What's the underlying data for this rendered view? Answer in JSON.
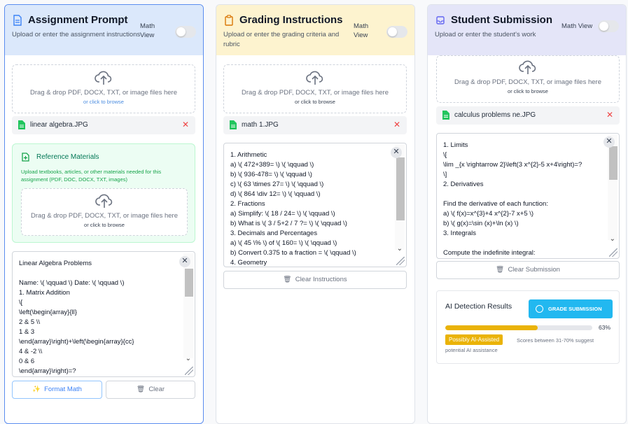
{
  "assignment": {
    "title": "Assignment Prompt",
    "subtitle": "Upload or enter the assignment instructions",
    "math_view": "Math\nView",
    "drop_text": "Drag & drop PDF, DOCX, TXT, or image files here",
    "drop_sub": "or click to browse",
    "file_name": "linear algebra.JPG",
    "reference": {
      "title": "Reference Materials",
      "subtitle": "Upload textbooks, articles, or other materials needed for this assignment (PDF, DOC, DOCX, TXT, images)",
      "drop_text": "Drag & drop PDF, DOCX, TXT, or image files here",
      "drop_sub": "or click to browse"
    },
    "text": "Linear Algebra Problems\n\nName: \\( \\qquad \\) Date: \\( \\qquad \\)\n1. Matrix Addition\n\\[\n\\left(\\begin{array}{ll}\n2 & 5 \\\\\n1 & 3\n\\end{array}\\right)+\\left(\\begin{array}{cc}\n4 & -2 \\\\\n0 & 6\n\\end{array}\\right)=?",
    "format_label": "Format Math",
    "clear_label": "Clear"
  },
  "grading": {
    "title": "Grading Instructions",
    "subtitle": "Upload or enter the grading criteria and rubric",
    "math_view": "Math\nView",
    "drop_text": "Drag & drop PDF, DOCX, TXT, or image files here",
    "drop_sub": "or click to browse",
    "file_name": "math 1.JPG",
    "text": "1. Arithmetic\na) \\( 472+389= \\) \\( \\qquad \\)\nb) \\( 936-478= \\) \\( \\qquad \\)\nc) \\( 63 \\times 27= \\) \\( \\qquad \\)\nd) \\( 864 \\div 12= \\) \\( \\qquad \\)\n2. Fractions\na) Simplify: \\( 18 / 24= \\) \\( \\qquad \\)\nb) What is \\( 3 / 5+2 / 7 ?= \\) \\( \\qquad \\)\n3. Decimals and Percentages\na) \\( 45 \\% \\) of \\( 160= \\) \\( \\qquad \\)\nb) Convert 0.375 to a fraction = \\( \\qquad \\)\n4. Geometry",
    "clear_label": "Clear Instructions"
  },
  "submission": {
    "title": "Student Submission",
    "subtitle": "Upload or enter the student's work",
    "math_view": "Math View",
    "drop_text": "Drag & drop PDF, DOCX, TXT, or image files here",
    "drop_sub": "or click to browse",
    "file_name": "calculus problems ne.JPG",
    "text": "1. Limits\n\\[\n\\lim _{x \\rightarrow 2}\\left(3 x^{2}-5 x+4\\right)=?\n\\]\n2. Derivatives\n\nFind the derivative of each function:\na) \\( f(x)=x^{3}+4 x^{2}-7 x+5 \\)\nb) \\( g(x)=\\sin (x)+\\ln (x) \\)\n3. Integrals\n\nCompute the indefinite integral:",
    "clear_label": "Clear Submission"
  },
  "ai_detection": {
    "title": "AI Detection Results",
    "grade_label": "GRADE SUBMISSION",
    "percent_label": "63%",
    "percent_value": 63,
    "badge": "Possibly AI-Assisted",
    "note": "Scores between 31-70% suggest potential AI assistance"
  },
  "close_glyph": "✕",
  "colors": {
    "accent_blue": "#3b82f6",
    "warning": "#eab308",
    "cyan": "#22b8f0",
    "danger": "#ef4444"
  }
}
